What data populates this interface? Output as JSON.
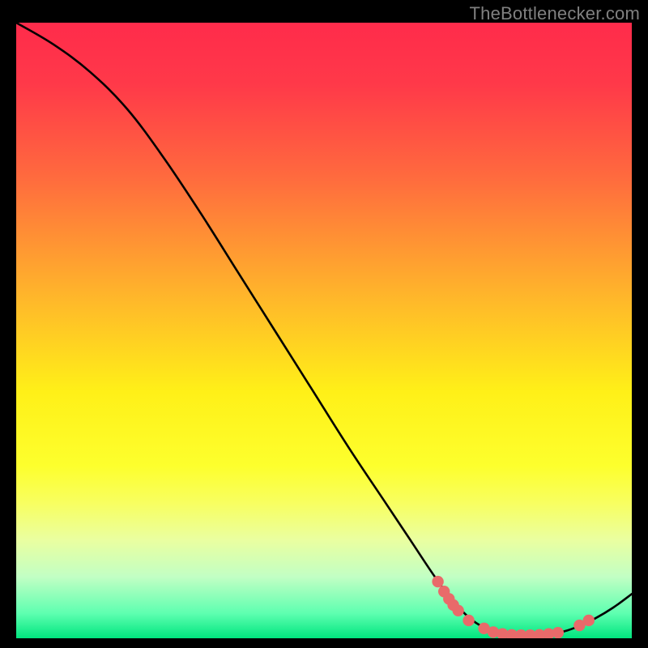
{
  "attribution": "TheBottlenecker.com",
  "chart_data": {
    "type": "line",
    "title": "",
    "xlabel": "",
    "ylabel": "",
    "xlim": [
      0,
      100
    ],
    "ylim": [
      0,
      100
    ],
    "gradient_stops": [
      {
        "offset": 0.0,
        "color": "#ff2b4b"
      },
      {
        "offset": 0.1,
        "color": "#ff3949"
      },
      {
        "offset": 0.25,
        "color": "#ff6a3e"
      },
      {
        "offset": 0.45,
        "color": "#ffb82a"
      },
      {
        "offset": 0.6,
        "color": "#fff018"
      },
      {
        "offset": 0.72,
        "color": "#fdff2d"
      },
      {
        "offset": 0.78,
        "color": "#f8ff60"
      },
      {
        "offset": 0.84,
        "color": "#eaffa0"
      },
      {
        "offset": 0.9,
        "color": "#c2ffc4"
      },
      {
        "offset": 0.96,
        "color": "#5dffb0"
      },
      {
        "offset": 1.0,
        "color": "#00e57e"
      }
    ],
    "series": [
      {
        "name": "curve",
        "type": "line",
        "color": "#000000",
        "points": [
          {
            "x": 0,
            "y": 100.0
          },
          {
            "x": 6,
            "y": 96.5
          },
          {
            "x": 12,
            "y": 92.0
          },
          {
            "x": 18,
            "y": 86.0
          },
          {
            "x": 24,
            "y": 78.0
          },
          {
            "x": 30,
            "y": 69.0
          },
          {
            "x": 36,
            "y": 59.5
          },
          {
            "x": 42,
            "y": 50.0
          },
          {
            "x": 48,
            "y": 40.5
          },
          {
            "x": 54,
            "y": 31.0
          },
          {
            "x": 60,
            "y": 22.0
          },
          {
            "x": 64,
            "y": 16.0
          },
          {
            "x": 68,
            "y": 10.0
          },
          {
            "x": 71,
            "y": 6.0
          },
          {
            "x": 74,
            "y": 3.0
          },
          {
            "x": 77,
            "y": 1.3
          },
          {
            "x": 80,
            "y": 0.6
          },
          {
            "x": 84,
            "y": 0.5
          },
          {
            "x": 88,
            "y": 0.9
          },
          {
            "x": 91,
            "y": 1.8
          },
          {
            "x": 94,
            "y": 3.2
          },
          {
            "x": 97,
            "y": 5.0
          },
          {
            "x": 100,
            "y": 7.2
          }
        ]
      },
      {
        "name": "markers",
        "type": "scatter",
        "color": "#e96a6a",
        "points": [
          {
            "x": 68.5,
            "y": 9.2
          },
          {
            "x": 69.5,
            "y": 7.6
          },
          {
            "x": 70.3,
            "y": 6.4
          },
          {
            "x": 71.0,
            "y": 5.4
          },
          {
            "x": 71.8,
            "y": 4.5
          },
          {
            "x": 73.5,
            "y": 2.9
          },
          {
            "x": 76.0,
            "y": 1.6
          },
          {
            "x": 77.5,
            "y": 1.0
          },
          {
            "x": 79.0,
            "y": 0.7
          },
          {
            "x": 80.5,
            "y": 0.55
          },
          {
            "x": 82.0,
            "y": 0.5
          },
          {
            "x": 83.5,
            "y": 0.5
          },
          {
            "x": 85.0,
            "y": 0.55
          },
          {
            "x": 86.5,
            "y": 0.7
          },
          {
            "x": 88.0,
            "y": 0.9
          },
          {
            "x": 91.5,
            "y": 2.1
          },
          {
            "x": 93.0,
            "y": 2.9
          }
        ]
      }
    ]
  }
}
